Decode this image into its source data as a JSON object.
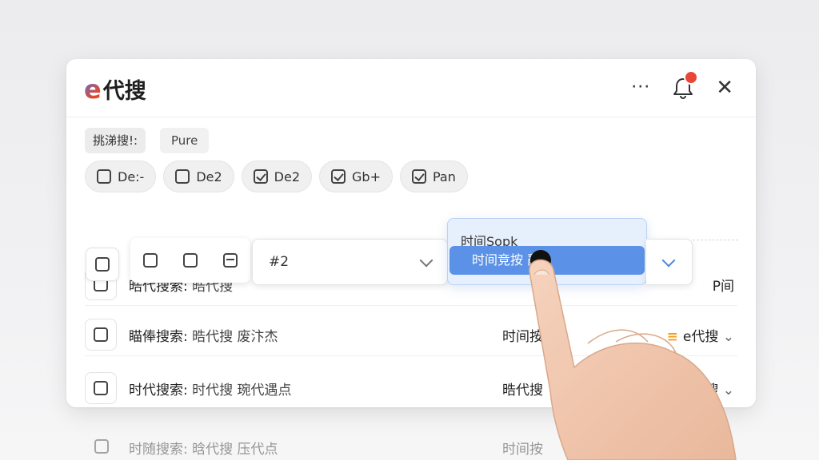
{
  "app": {
    "logo_letter": "e",
    "title": "代搜"
  },
  "header": {
    "more_icon": "more-icon",
    "bell_icon": "bell-icon",
    "close_icon": "close-icon"
  },
  "filter_label": "挑涕搜!:",
  "filter_value": "Pure",
  "filters": [
    {
      "label": "De:-",
      "checked": false
    },
    {
      "label": "De2",
      "checked": false
    },
    {
      "label": "De2",
      "checked": true
    },
    {
      "label": "Gb+",
      "checked": true
    },
    {
      "label": "Pan",
      "checked": true
    }
  ],
  "select1": {
    "value": "#2"
  },
  "dropdown": {
    "header": "时间Sopk",
    "selected_option": "时间竞按  辭"
  },
  "rows": [
    {
      "title": "瞄俸搜索:",
      "rest": "晧代搜 废汴杰",
      "time": "时间按",
      "source": "e代搜"
    },
    {
      "title": "时代搜索:",
      "rest": "时代搜 琬代遇点",
      "time": "晧代搜",
      "source": "搜"
    }
  ],
  "partial_row": {
    "title": "晧代搜索:",
    "rest": "晧代搜",
    "source": "P间"
  },
  "reflection_row": {
    "title": "时随搜索:",
    "rest": "晗代搜 压代点",
    "time": "时间按"
  },
  "colors": {
    "accent": "#5b92e8",
    "badge": "#e9463a",
    "menu_icon": "#f0a020"
  }
}
